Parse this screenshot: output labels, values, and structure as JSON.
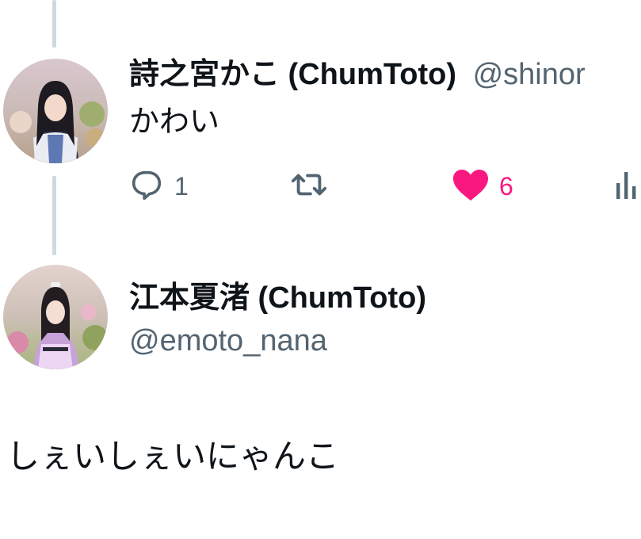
{
  "colors": {
    "like_active": "#f91880",
    "icon_gray": "#536471",
    "thread_line": "#cfd9de",
    "text_primary": "#0f1419",
    "text_secondary": "#536471"
  },
  "reply_tweet": {
    "display_name": "詩之宮かこ (ChumToto)",
    "handle": "@shinor",
    "text": "かわい",
    "avatar_icon": "user-avatar-photo",
    "actions": {
      "reply": {
        "icon": "reply-bubble-icon",
        "count": "1"
      },
      "retweet": {
        "icon": "retweet-icon",
        "count": ""
      },
      "like": {
        "icon": "heart-icon",
        "count": "6",
        "liked": true
      },
      "views": {
        "icon": "bar-chart-icon",
        "count": ""
      }
    }
  },
  "main_tweet": {
    "display_name": "江本夏渚 (ChumToto)",
    "handle": "@emoto_nana",
    "text": "しぇいしぇいにゃんこ",
    "avatar_icon": "user-avatar-photo"
  }
}
